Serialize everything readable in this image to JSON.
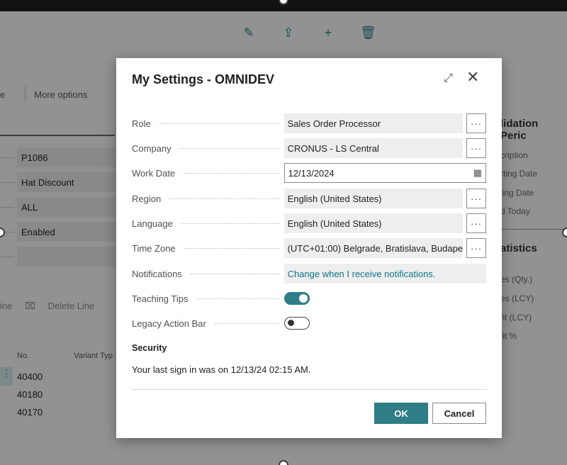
{
  "background": {
    "toolbar_icons": [
      "pencil-icon",
      "share-icon",
      "plus-icon",
      "trash-icon"
    ],
    "actions": {
      "partial": "e",
      "more_options": "More options"
    },
    "fields": [
      "P1086",
      "Hat Discount",
      "ALL",
      "Enabled"
    ],
    "line_actions": {
      "partial": "ine",
      "delete_line": "Delete Line"
    },
    "table_headers": {
      "no": "No.",
      "variant": "Variant Typ"
    },
    "table_rows": [
      "40400",
      "40180",
      "40170"
    ],
    "right_panel": {
      "title": "lidation Peric",
      "items": [
        "cription",
        "rting Date",
        "ling Date",
        "d Today"
      ],
      "stats_title": "atistics",
      "stats": [
        "es (Qty.)",
        "es (LCY)",
        "fit (LCY)",
        "fit %"
      ]
    }
  },
  "dialog": {
    "title": "My Settings - OMNIDEV",
    "fields": {
      "role": {
        "label": "Role",
        "value": "Sales Order Processor"
      },
      "company": {
        "label": "Company",
        "value": "CRONUS - LS Central"
      },
      "work_date": {
        "label": "Work Date",
        "value": "12/13/2024"
      },
      "region": {
        "label": "Region",
        "value": "English (United States)"
      },
      "language": {
        "label": "Language",
        "value": "English (United States)"
      },
      "time_zone": {
        "label": "Time Zone",
        "value": "(UTC+01:00) Belgrade, Bratislava, Budape..."
      },
      "notifications": {
        "label": "Notifications",
        "value": "Change when I receive notifications."
      },
      "teaching_tips": {
        "label": "Teaching Tips",
        "state": "on"
      },
      "legacy_action_bar": {
        "label": "Legacy Action Bar",
        "state": "off"
      }
    },
    "more_label": "···",
    "security": {
      "title": "Security",
      "text": "Your last sign in was on 12/13/24 02:15 AM."
    },
    "buttons": {
      "ok": "OK",
      "cancel": "Cancel"
    }
  },
  "colors": {
    "accent": "#2e7d87",
    "link": "#0e7686"
  }
}
